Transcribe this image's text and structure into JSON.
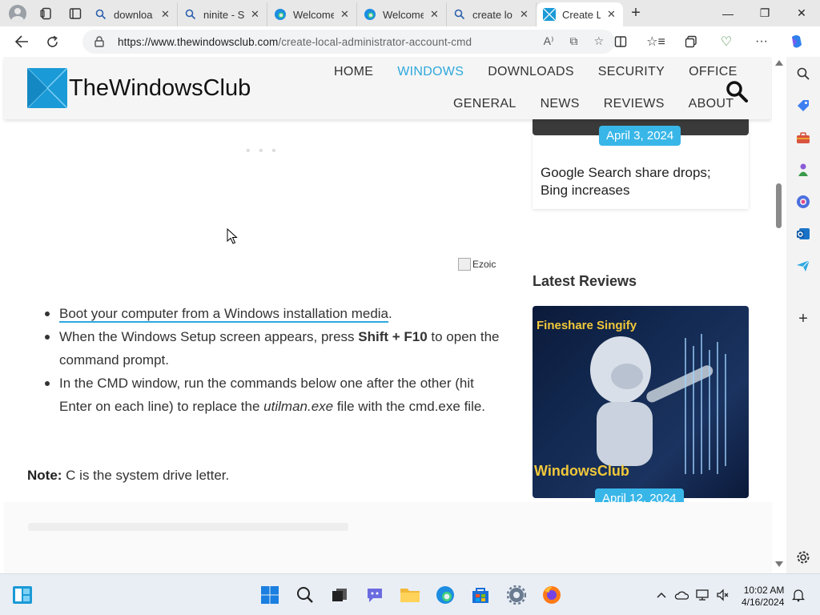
{
  "browser": {
    "tabs": [
      {
        "title": "downloa",
        "icon": "search-icon",
        "active": false
      },
      {
        "title": "ninite - S",
        "icon": "search-icon",
        "active": false
      },
      {
        "title": "Welcome",
        "icon": "edge-icon",
        "active": false
      },
      {
        "title": "Welcome",
        "icon": "edge-icon",
        "active": false
      },
      {
        "title": "create lo",
        "icon": "search-icon",
        "active": false
      },
      {
        "title": "Create Lo",
        "icon": "twc-icon",
        "active": true
      }
    ],
    "url_host": "https://www.thewindowsclub.com",
    "url_path": "/create-local-administrator-account-cmd"
  },
  "site": {
    "logo_text": "TheWindowsClub",
    "nav_primary": [
      "HOME",
      "WINDOWS",
      "DOWNLOADS",
      "SECURITY",
      "OFFICE"
    ],
    "nav_secondary": [
      "GENERAL",
      "NEWS",
      "REVIEWS",
      "ABOUT"
    ],
    "active_nav": "WINDOWS",
    "accent_color": "#2ea8dd"
  },
  "article": {
    "loading_dots": "• • •",
    "ad_label": "Ezoic",
    "steps": [
      {
        "link": "Boot your computer from a Windows installation media",
        "after": "."
      },
      {
        "before": "When the Windows Setup screen appears, press ",
        "bold": "Shift + F10",
        "after": " to open the command prompt."
      },
      {
        "before": "In the CMD window, run the commands below one after the other (hit Enter on each line) to replace the ",
        "italic": "utilman.exe",
        "after": " file with the cmd.exe file."
      }
    ],
    "note_label": "Note:",
    "note_text": " C is the system drive letter."
  },
  "sidebar": {
    "top_card": {
      "date": "April 3, 2024",
      "title": "Google Search share drops; Bing increases"
    },
    "latest_heading": "Latest Reviews",
    "review": {
      "image_brand": "Fineshare Singify",
      "image_watermark": "WindowsClub",
      "date": "April 12, 2024"
    }
  },
  "taskbar": {
    "time": "10:02 AM",
    "date": "4/16/2024"
  }
}
